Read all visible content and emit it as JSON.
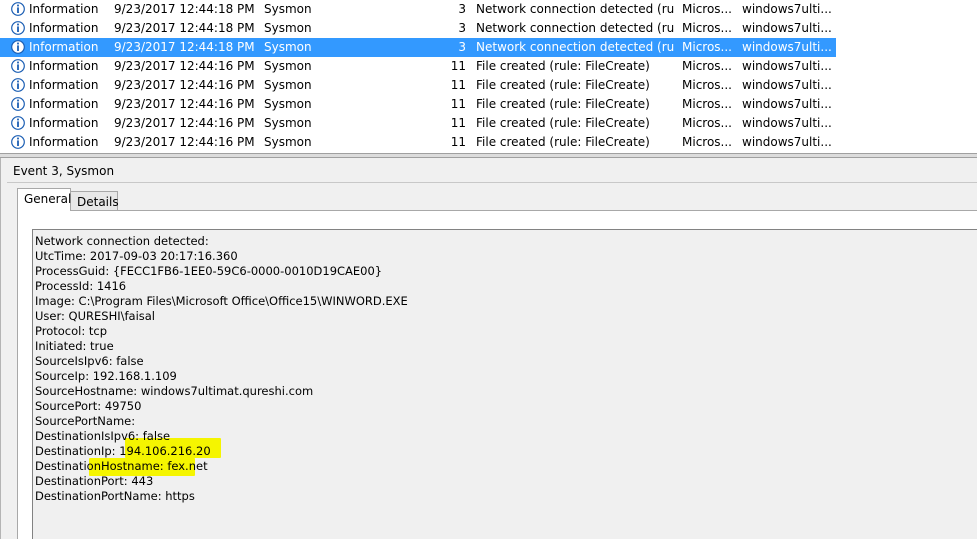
{
  "event_list": {
    "rows": [
      {
        "level": "Information",
        "date": "9/23/2017 12:44:18 PM",
        "source": "Sysmon",
        "event_id": "3",
        "task": "Network connection detected (rule...",
        "opcode": "Micros...",
        "computer": "windows7ulti...",
        "selected": false
      },
      {
        "level": "Information",
        "date": "9/23/2017 12:44:18 PM",
        "source": "Sysmon",
        "event_id": "3",
        "task": "Network connection detected (rule...",
        "opcode": "Micros...",
        "computer": "windows7ulti...",
        "selected": false
      },
      {
        "level": "Information",
        "date": "9/23/2017 12:44:18 PM",
        "source": "Sysmon",
        "event_id": "3",
        "task": "Network connection detected (rule...",
        "opcode": "Micros...",
        "computer": "windows7ulti...",
        "selected": true
      },
      {
        "level": "Information",
        "date": "9/23/2017 12:44:16 PM",
        "source": "Sysmon",
        "event_id": "11",
        "task": "File created (rule: FileCreate)",
        "opcode": "Micros...",
        "computer": "windows7ulti...",
        "selected": false
      },
      {
        "level": "Information",
        "date": "9/23/2017 12:44:16 PM",
        "source": "Sysmon",
        "event_id": "11",
        "task": "File created (rule: FileCreate)",
        "opcode": "Micros...",
        "computer": "windows7ulti...",
        "selected": false
      },
      {
        "level": "Information",
        "date": "9/23/2017 12:44:16 PM",
        "source": "Sysmon",
        "event_id": "11",
        "task": "File created (rule: FileCreate)",
        "opcode": "Micros...",
        "computer": "windows7ulti...",
        "selected": false
      },
      {
        "level": "Information",
        "date": "9/23/2017 12:44:16 PM",
        "source": "Sysmon",
        "event_id": "11",
        "task": "File created (rule: FileCreate)",
        "opcode": "Micros...",
        "computer": "windows7ulti...",
        "selected": false
      },
      {
        "level": "Information",
        "date": "9/23/2017 12:44:16 PM",
        "source": "Sysmon",
        "event_id": "11",
        "task": "File created (rule: FileCreate)",
        "opcode": "Micros...",
        "computer": "windows7ulti...",
        "selected": false
      }
    ],
    "level_icon": "information-icon"
  },
  "detail": {
    "title": "Event 3, Sysmon",
    "tabs": [
      {
        "label": "General",
        "active": true
      },
      {
        "label": "Details",
        "active": false
      }
    ],
    "message_lines": [
      "Network connection detected:",
      "UtcTime: 2017-09-03 20:17:16.360",
      "ProcessGuid: {FECC1FB6-1EE0-59C6-0000-0010D19CAE00}",
      "ProcessId: 1416",
      "Image: C:\\Program Files\\Microsoft Office\\Office15\\WINWORD.EXE",
      "User: QURESHI\\faisal",
      "Protocol: tcp",
      "Initiated: true",
      "SourceIsIpv6: false",
      "SourceIp: 192.168.1.109",
      "SourceHostname: windows7ultimat.qureshi.com",
      "SourcePort: 49750",
      "SourcePortName:",
      "DestinationIsIpv6: false",
      "DestinationIp: 194.106.216.20",
      "DestinationHostname: fex.net",
      "DestinationPort: 443",
      "DestinationPortName: https"
    ],
    "highlighted_lines": [
      "DestinationIp: 194.106.216.20",
      "DestinationHostname: fex.net"
    ]
  },
  "colors": {
    "selection": "#3399ff",
    "highlight": "#f5f500",
    "info_icon": "#1c5fb4"
  }
}
